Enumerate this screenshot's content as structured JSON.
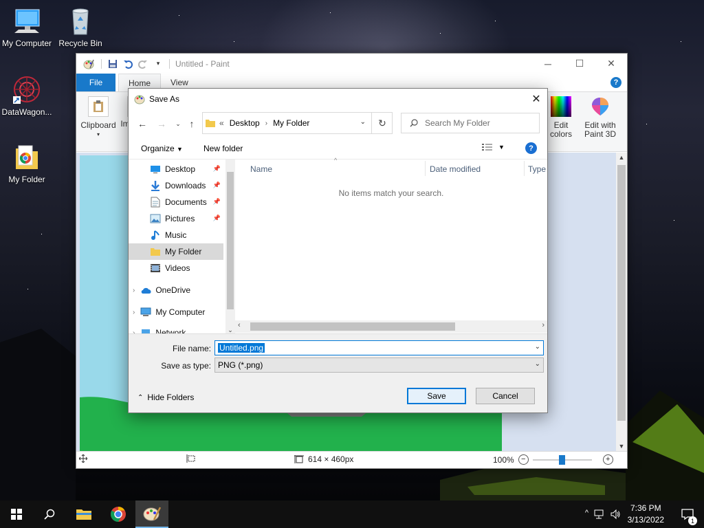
{
  "desktop": {
    "icons": [
      {
        "label": "My Computer",
        "icon": "monitor-icon"
      },
      {
        "label": "Recycle Bin",
        "icon": "recycle-bin-icon"
      },
      {
        "label": "DataWagon...",
        "icon": "shortcut-icon"
      },
      {
        "label": "My Folder",
        "icon": "folder-icon"
      }
    ]
  },
  "paint": {
    "title": "Untitled - Paint",
    "tabs": [
      "File",
      "Home",
      "View"
    ],
    "ribbon": {
      "clipboard": "Clipboard",
      "image_partial": "Im",
      "edit_colors": "Edit colors",
      "edit_paint3d_line1": "Edit with",
      "edit_paint3d_line2": "Paint 3D"
    },
    "status": {
      "dimensions": "614 × 460px",
      "zoom": "100%"
    }
  },
  "dialog": {
    "title": "Save As",
    "address": {
      "overflow": "«",
      "crumb1": "Desktop",
      "crumb2": "My Folder"
    },
    "search_placeholder": "Search My Folder",
    "organize": "Organize",
    "new_folder": "New folder",
    "nav": [
      {
        "label": "Desktop",
        "icon": "desktop-icon",
        "pinned": true
      },
      {
        "label": "Downloads",
        "icon": "download-icon",
        "pinned": true
      },
      {
        "label": "Documents",
        "icon": "documents-icon",
        "pinned": true
      },
      {
        "label": "Pictures",
        "icon": "pictures-icon",
        "pinned": true
      },
      {
        "label": "Music",
        "icon": "music-icon",
        "pinned": false
      },
      {
        "label": "My Folder",
        "icon": "folder-icon",
        "pinned": false,
        "selected": true
      },
      {
        "label": "Videos",
        "icon": "videos-icon",
        "pinned": false
      },
      {
        "label": "OneDrive",
        "icon": "cloud-icon",
        "pinned": false
      },
      {
        "label": "My Computer",
        "icon": "monitor-icon",
        "pinned": false
      },
      {
        "label": "Network",
        "icon": "network-icon",
        "pinned": false
      }
    ],
    "columns": [
      "Name",
      "Date modified",
      "Type"
    ],
    "empty_message": "No items match your search.",
    "file_name_label": "File name:",
    "file_name_value": "Untitled.png",
    "save_type_label": "Save as type:",
    "save_type_value": "PNG (*.png)",
    "hide_folders": "Hide Folders",
    "save_button": "Save",
    "cancel_button": "Cancel"
  },
  "taskbar": {
    "time": "7:36 PM",
    "date": "3/13/2022",
    "notifications": "1"
  },
  "colors": {
    "accent": "#0078d7",
    "file_tab": "#1979ca",
    "canvas_bg": "#d6e0f0",
    "grass": "#22b14c"
  }
}
